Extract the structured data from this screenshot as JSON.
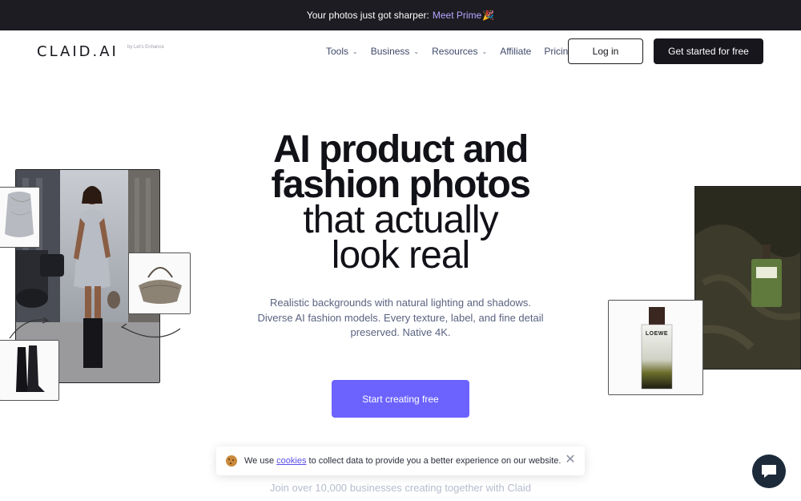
{
  "announcement": {
    "text": "Your photos just got sharper:",
    "link": "Meet Prime",
    "emoji": "🎉"
  },
  "nav": {
    "logo": "CLAID.AI",
    "logo_sub": "by Let's Enhance",
    "items": [
      {
        "label": "Tools",
        "dropdown": true
      },
      {
        "label": "Business",
        "dropdown": true
      },
      {
        "label": "Resources",
        "dropdown": true
      },
      {
        "label": "Affiliate",
        "dropdown": false
      },
      {
        "label": "Pricing",
        "dropdown": false
      }
    ],
    "login": "Log in",
    "get_started": "Get started for free"
  },
  "hero": {
    "title_bold_1": "AI product and",
    "title_bold_2": "fashion photos",
    "title_light_1": "that actually",
    "title_light_2": "look real",
    "subtitle": "Realistic backgrounds with natural lighting and shadows. Diverse AI fashion models. Every texture, label, and fine detail preserved. Native 4K.",
    "cta": "Start creating free",
    "join": "Join over 10,000 businesses creating together with Claid"
  },
  "cookie": {
    "pre": "We use",
    "link": "cookies",
    "post": "to collect data to provide you a better experience on our website."
  },
  "product_label": "LOEWE",
  "colors": {
    "accent": "#6c63ff",
    "dark": "#16161c",
    "announce_bg": "#1c1c22"
  }
}
